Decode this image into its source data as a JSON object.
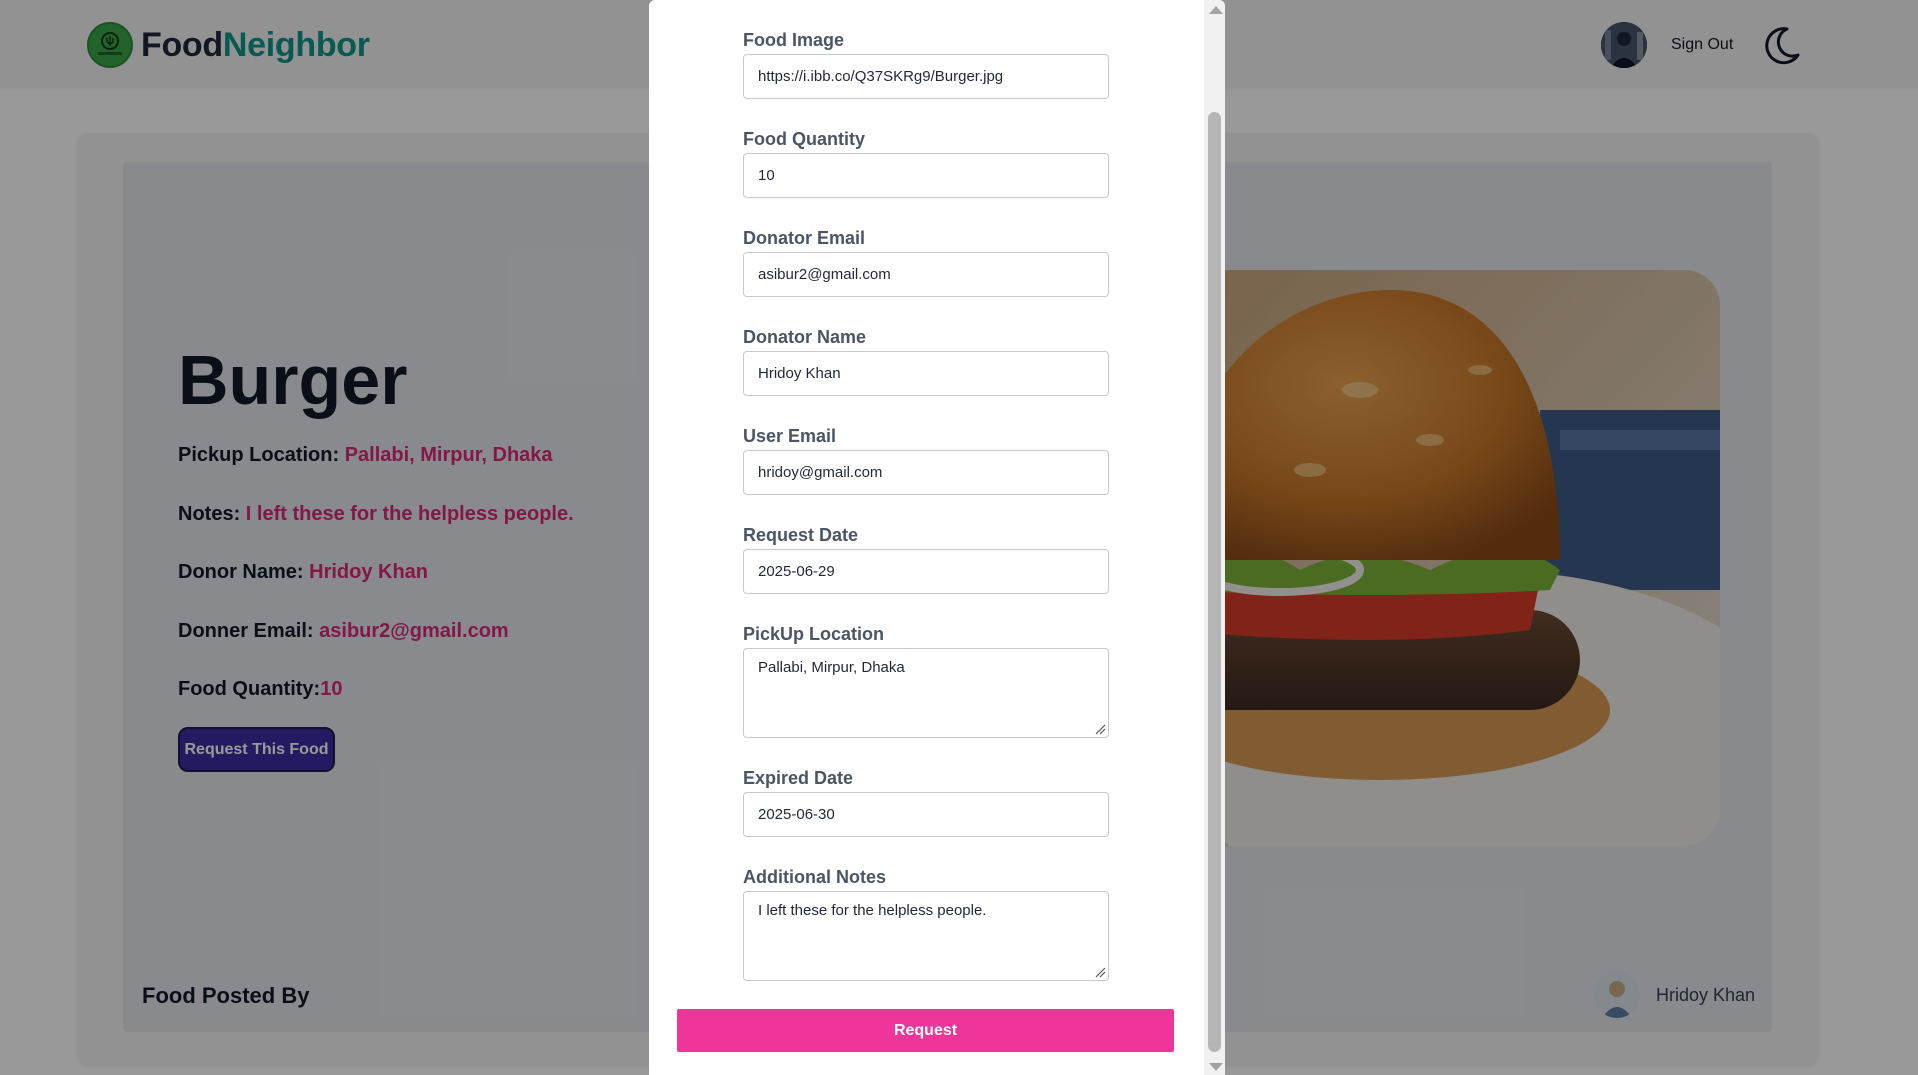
{
  "navbar": {
    "brand_part1": "Food",
    "brand_part2": "Neighbor",
    "sign_out": "Sign Out",
    "theme_icon": "moon-icon"
  },
  "details": {
    "title": "Burger",
    "pickup_label": "Pickup Location: ",
    "pickup_value": "Pallabi, Mirpur, Dhaka",
    "notes_label": "Notes: ",
    "notes_value": "I left these for the helpless people.",
    "donor_label": "Donor Name: ",
    "donor_value": "Hridoy Khan",
    "email_label": "Donner Email: ",
    "email_value": "asibur2@gmail.com",
    "quantity_label": "Food Quantity:",
    "quantity_value": "10",
    "request_button": "Request This Food"
  },
  "posted_by": {
    "label": "Food Posted By",
    "name": "Hridoy Khan"
  },
  "modal": {
    "fields": {
      "food_image": {
        "label": "Food Image",
        "value": "https://i.ibb.co/Q37SKRg9/Burger.jpg"
      },
      "food_quantity": {
        "label": "Food Quantity",
        "value": "10"
      },
      "donator_email": {
        "label": "Donator Email",
        "value": "asibur2@gmail.com"
      },
      "donator_name": {
        "label": "Donator Name",
        "value": "Hridoy Khan"
      },
      "user_email": {
        "label": "User Email",
        "value": "hridoy@gmail.com"
      },
      "request_date": {
        "label": "Request Date",
        "value": "2025-06-29"
      },
      "pickup_location": {
        "label": "PickUp Location",
        "value": "Pallabi, Mirpur, Dhaka"
      },
      "expired_date": {
        "label": "Expired Date",
        "value": "2025-06-30"
      },
      "additional_notes": {
        "label": "Additional Notes",
        "value": "I left these for the helpless people."
      }
    },
    "submit_label": "Request"
  },
  "colors": {
    "accent_pink": "#f0359a",
    "value_pink": "#db2777",
    "brand_teal": "#0d9488",
    "button_indigo": "#3b2ea3"
  }
}
